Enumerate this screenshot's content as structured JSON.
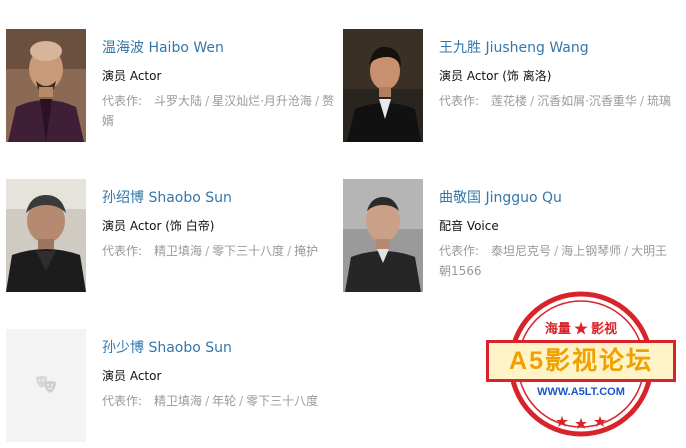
{
  "cast": [
    {
      "name": "温海波 Haibo Wen",
      "role": "演员 Actor",
      "works_label": "代表作:",
      "works": [
        "斗罗大陆",
        "星汉灿烂·月升沧海",
        "赘婿"
      ]
    },
    {
      "name": "王九胜 Jiusheng Wang",
      "role": "演员 Actor (饰 离洛)",
      "works_label": "代表作:",
      "works": [
        "莲花楼",
        "沉香如屑·沉香重华",
        "琉璃"
      ]
    },
    {
      "name": "孙绍博 Shaobo Sun",
      "role": "演员 Actor (饰 白帝)",
      "works_label": "代表作:",
      "works": [
        "精卫填海",
        "零下三十八度",
        "掩护"
      ]
    },
    {
      "name": "曲敬国 Jingguo Qu",
      "role": "配音 Voice",
      "works_label": "代表作:",
      "works": [
        "泰坦尼克号",
        "海上钢琴师",
        "大明王朝1566"
      ]
    },
    {
      "name": "孙少博 Shaobo Sun",
      "role": "演员 Actor",
      "works_label": "代表作:",
      "works": [
        "精卫填海",
        "年轮",
        "零下三十八度"
      ]
    }
  ],
  "watermark": {
    "top_text": "海量 ★ 影视",
    "banner_text": "A5影视论坛",
    "url_text": "WWW.A5LT.COM"
  }
}
